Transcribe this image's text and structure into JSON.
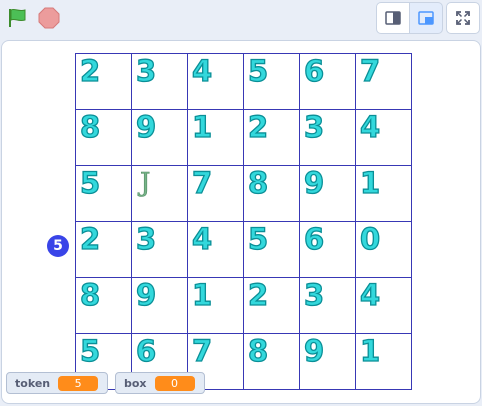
{
  "toolbar": {
    "green_flag_icon": "green-flag-icon",
    "stop_icon": "stop-sign-icon",
    "small_stage_icon": "small-stage-icon",
    "large_stage_icon": "large-stage-icon",
    "fullscreen_icon": "fullscreen-icon"
  },
  "colors": {
    "grid_line": "#3838b5",
    "digit_fill": "#33d8dc",
    "digit_outline": "#0a8f97",
    "sprite_dot": "#3944e8",
    "monitor_value": "#ff8c1a"
  },
  "grid": {
    "rows": [
      [
        "2",
        "3",
        "4",
        "5",
        "6",
        "7"
      ],
      [
        "8",
        "9",
        "1",
        "2",
        "3",
        "4"
      ],
      [
        "5",
        "J",
        "7",
        "8",
        "9",
        "1"
      ],
      [
        "2",
        "3",
        "4",
        "5",
        "6",
        "0"
      ],
      [
        "8",
        "9",
        "1",
        "2",
        "3",
        "4"
      ],
      [
        "5",
        "6",
        "7",
        "8",
        "9",
        "1"
      ]
    ]
  },
  "sprite_badge": "5",
  "monitors": [
    {
      "label": "token",
      "value": "5"
    },
    {
      "label": "box",
      "value": "0"
    }
  ]
}
